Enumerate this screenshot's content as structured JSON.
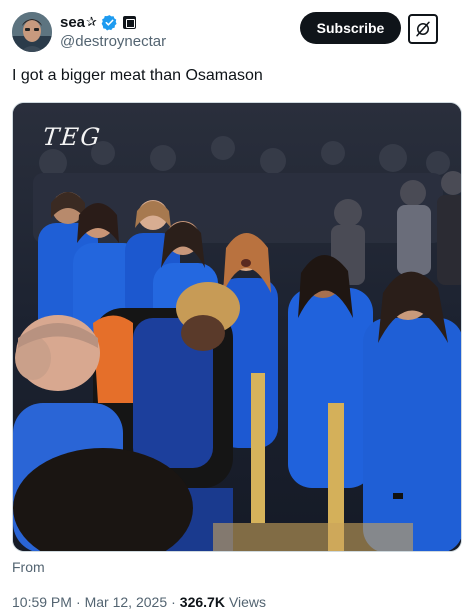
{
  "author": {
    "display_name": "sea",
    "name_emoji": "✰",
    "handle": "@destroynectar",
    "verified": true
  },
  "actions": {
    "subscribe_label": "Subscribe",
    "grok_icon": "grok-icon"
  },
  "tweet": {
    "text": "I got a bigger meat than Osamason",
    "media_overlay_text": "TEG",
    "from_label": "From"
  },
  "meta": {
    "time": "10:59 PM",
    "date": "Mar 12, 2025",
    "separator": "·",
    "views_count": "326.7K",
    "views_label": "Views"
  },
  "colors": {
    "verified_blue": "#1d9bf0",
    "text_primary": "#0f1419",
    "text_secondary": "#536471",
    "jersey_blue": "#1f5fd6"
  }
}
